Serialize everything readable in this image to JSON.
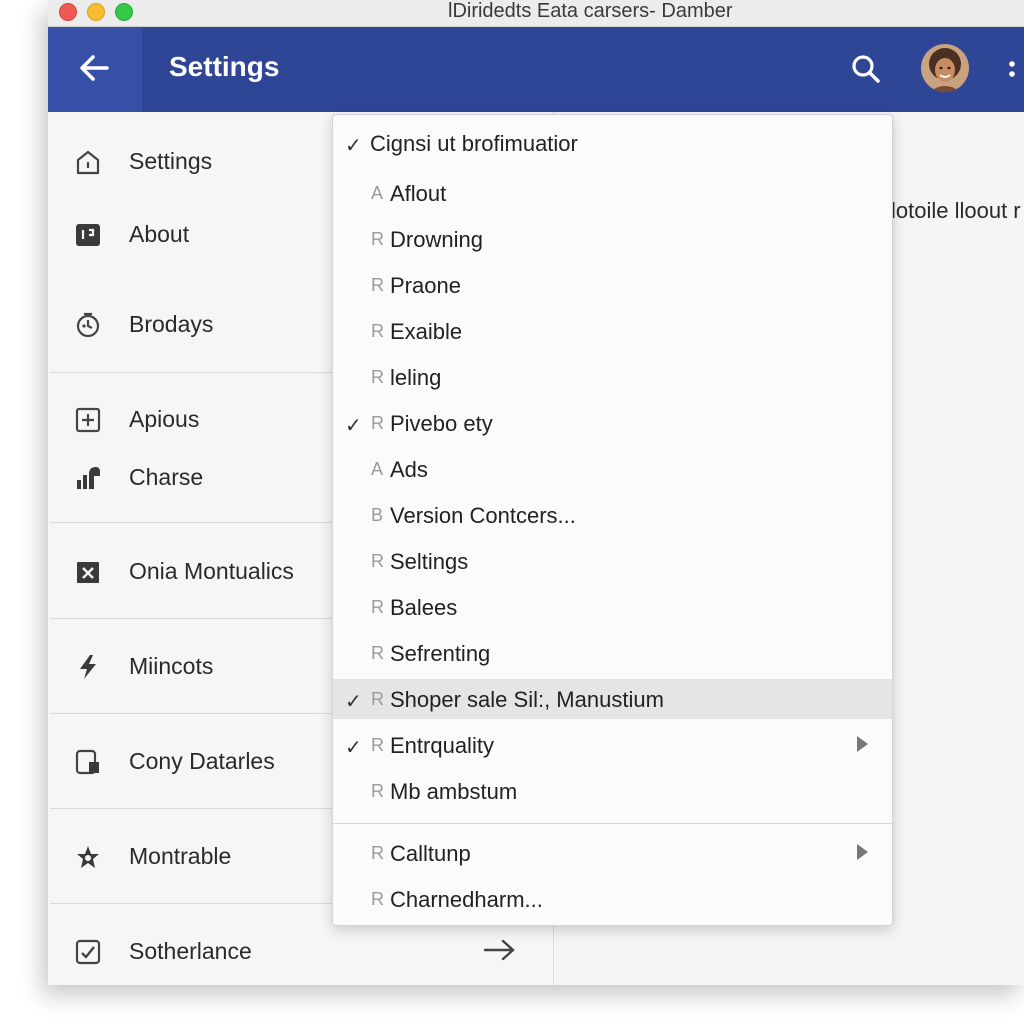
{
  "window": {
    "title": "lDiridedts Eata carsers- Damber"
  },
  "appbar": {
    "back_icon": "arrow-left-icon",
    "title": "Settings",
    "search_icon": "search-icon",
    "more_icon": "more-vert-icon",
    "color": "#2f4595"
  },
  "sidebar": {
    "items": [
      {
        "label": "Settings",
        "icon": "home-icon"
      },
      {
        "label": "About",
        "icon": "info-card-icon"
      },
      {
        "label": "Brodays",
        "icon": "timer-icon"
      },
      {
        "label": "Apious",
        "icon": "add-box-icon"
      },
      {
        "label": "Charse",
        "icon": "chart-icon"
      },
      {
        "label": "Onia Montualics",
        "icon": "close-box-icon"
      },
      {
        "label": "Miincots",
        "icon": "bolt-icon"
      },
      {
        "label": "Cony Datarles",
        "icon": "device-icon"
      },
      {
        "label": "Montrable",
        "icon": "star-icon"
      },
      {
        "label": "Sotherlance",
        "icon": "checkbox-icon"
      }
    ],
    "trailing_icon": "arrow-right-icon"
  },
  "content": {
    "side_text": "lotoile lloout r"
  },
  "menu": {
    "header": {
      "label": "Cignsi ut brofimuatior",
      "checked": true
    },
    "items": [
      {
        "prefix": "A",
        "label": "Aflout",
        "checked": false,
        "submenu": false
      },
      {
        "prefix": "R",
        "label": "Drowning",
        "checked": false,
        "submenu": false
      },
      {
        "prefix": "R",
        "label": "Praone",
        "checked": false,
        "submenu": false
      },
      {
        "prefix": "R",
        "label": "Exaible",
        "checked": false,
        "submenu": false
      },
      {
        "prefix": "R",
        "label": "leling",
        "checked": false,
        "submenu": false
      },
      {
        "prefix": "R",
        "label": "Pivebo ety",
        "checked": true,
        "submenu": false
      },
      {
        "prefix": "A",
        "label": "Ads",
        "checked": false,
        "submenu": false
      },
      {
        "prefix": "B",
        "label": "Version Contcers...",
        "checked": false,
        "submenu": false
      },
      {
        "prefix": "R",
        "label": "Seltings",
        "checked": false,
        "submenu": false
      },
      {
        "prefix": "R",
        "label": "Balees",
        "checked": false,
        "submenu": false
      },
      {
        "prefix": "R",
        "label": "Sefrenting",
        "checked": false,
        "submenu": false
      },
      {
        "prefix": "R",
        "label": "Shoper sale Sil:, Manustium",
        "checked": true,
        "submenu": false,
        "highlighted": true
      },
      {
        "prefix": "R",
        "label": "Entrquality",
        "checked": true,
        "submenu": true
      },
      {
        "prefix": "R",
        "label": "Mb ambstum",
        "checked": false,
        "submenu": false
      },
      {
        "prefix": "R",
        "label": "Calltunp",
        "checked": false,
        "submenu": true
      },
      {
        "prefix": "R",
        "label": "Charnedharm...",
        "checked": false,
        "submenu": false
      }
    ]
  }
}
